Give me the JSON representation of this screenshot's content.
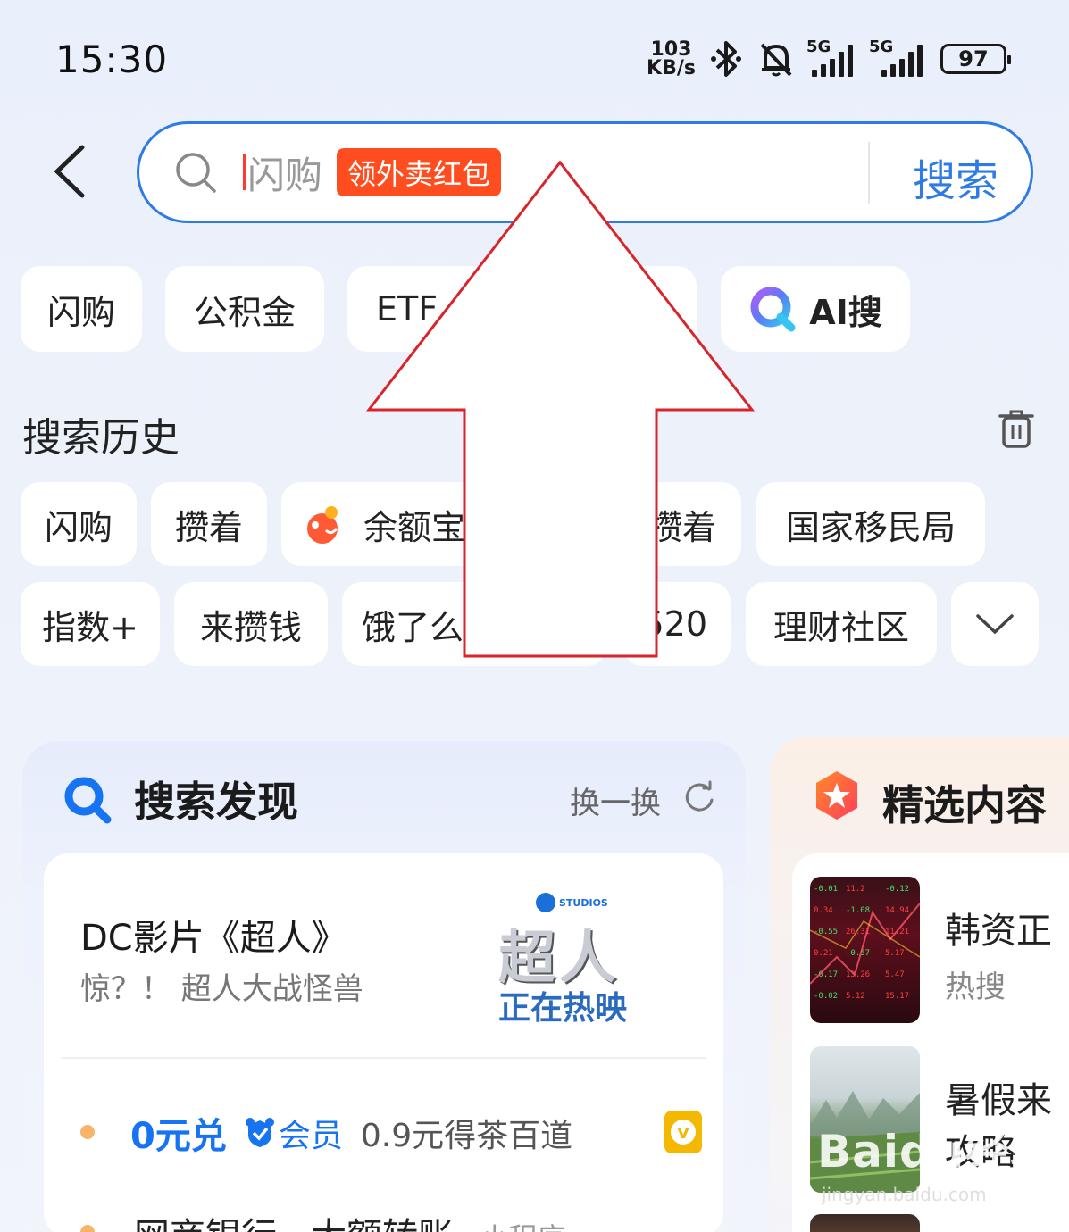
{
  "status_bar": {
    "time": "15:30",
    "net_speed_value": "103",
    "net_speed_unit": "KB/s",
    "signal_1_label": "5G",
    "signal_2_label": "5G",
    "battery": "97"
  },
  "search": {
    "placeholder": "闪购",
    "promo_tag": "领外卖红包",
    "button": "搜索"
  },
  "quick_chips": [
    {
      "label": "闪购"
    },
    {
      "label": "公积金"
    },
    {
      "label": "ETF"
    },
    {
      "label": ""
    },
    {
      "label": "AI搜"
    }
  ],
  "history": {
    "title": "搜索历史",
    "items_row1": [
      "闪购",
      "攒着",
      "余额宝",
      "攒着",
      "国家移民局"
    ],
    "items_row2": [
      "指数+",
      "来攒钱",
      "饿了么",
      "520",
      "理财社区"
    ]
  },
  "discover": {
    "title": "搜索发现",
    "refresh_label": "换一换",
    "feature": {
      "title": "DC影片《超人》",
      "subtitle": "惊？！ 超人大战怪兽",
      "poster_studio": "STUDIOS",
      "poster_title": "超人",
      "poster_sub": "正在热映"
    },
    "rows": [
      {
        "highlight": "0元兑",
        "badge": "会员",
        "text": "0.9元得茶百道"
      },
      {
        "text": "网商银行 · 大额转账",
        "tag": "小程序"
      }
    ]
  },
  "featured": {
    "title": "精选内容",
    "items": [
      {
        "title": "韩资正",
        "tag": "热搜"
      },
      {
        "title": "暑假来",
        "title2": "攻略"
      }
    ]
  },
  "watermark": {
    "brand": "Baidu经验",
    "url": "jingyan.baidu.com"
  },
  "colors": {
    "accent": "#2e7be8",
    "promo": "#ff4d1f",
    "arrow": "#d9242b"
  }
}
